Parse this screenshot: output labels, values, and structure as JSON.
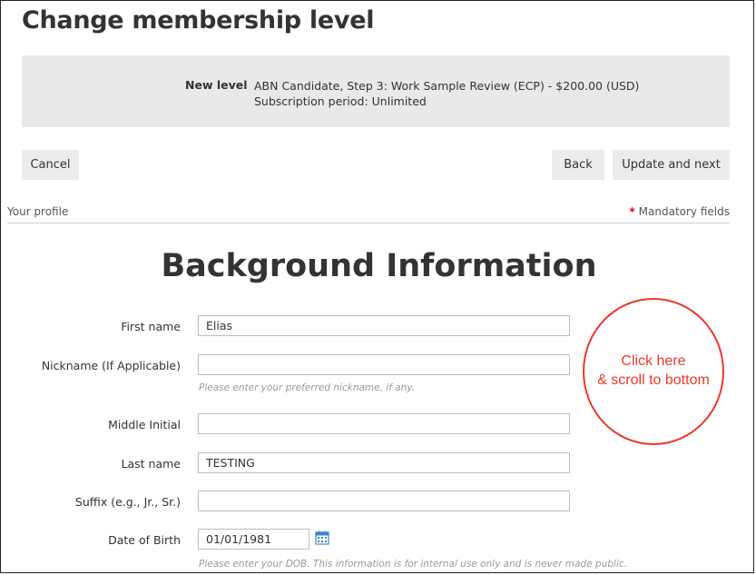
{
  "page": {
    "title": "Change membership level"
  },
  "level": {
    "label": "New level",
    "value": "ABN Candidate, Step 3: Work Sample Review (ECP) - $200.00 (USD)",
    "period": "Subscription period: Unlimited"
  },
  "buttons": {
    "cancel": "Cancel",
    "back": "Back",
    "update": "Update and next"
  },
  "section": {
    "label": "Your profile",
    "mandatory_star": "*",
    "mandatory": "Mandatory fields"
  },
  "form": {
    "heading": "Background Information",
    "first_name": {
      "label": "First name",
      "value": "Elias"
    },
    "nickname": {
      "label": "Nickname (If Applicable)",
      "value": "",
      "hint": "Please enter your preferred nickname, if any."
    },
    "middle_initial": {
      "label": "Middle Initial",
      "value": ""
    },
    "last_name": {
      "label": "Last name",
      "value": "TESTING"
    },
    "suffix": {
      "label": "Suffix (e.g., Jr., Sr.)",
      "value": ""
    },
    "dob": {
      "label": "Date of Birth",
      "value": "01/01/1981",
      "hint": "Please enter your DOB. This information is for internal use only and is never made public."
    }
  },
  "annotation": {
    "line1": "Click here",
    "line2": "& scroll to bottom",
    "color": "#e8392a"
  },
  "icons": {
    "calendar": "calendar-icon"
  }
}
